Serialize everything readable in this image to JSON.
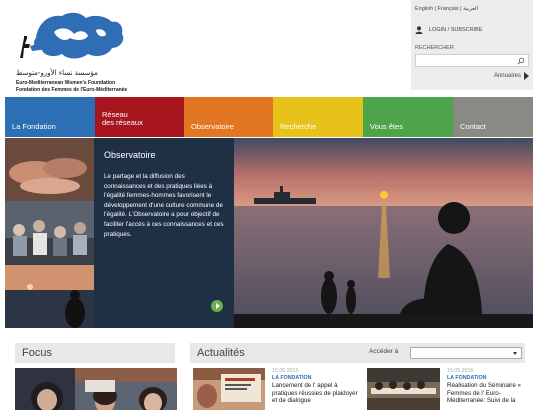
{
  "brand": {
    "arabic_name": "مؤسسة نساء الأورو-متوسط",
    "english_name": "Euro-Mediterranean Women's Foundation",
    "french_name": "Fondation des Femmes de l'Euro-Méditerranée",
    "colors": {
      "blue": "#2f6db5",
      "dark": "#1f2f44"
    }
  },
  "topbar": {
    "languages": "English | Français | العربية",
    "login": "LOGIN / SUBSCRIBE",
    "search_label": "RECHERCHER",
    "search_placeholder": "",
    "annuaires": "Annuaires"
  },
  "nav": [
    {
      "line1": "La Fondation",
      "line2": "",
      "color": "#2c6fb4"
    },
    {
      "line1": "Réseau",
      "line2": "des réseaux",
      "color": "#a7161f"
    },
    {
      "line1": "Observatoire",
      "line2": "",
      "color": "#e37622"
    },
    {
      "line1": "Recherche",
      "line2": "",
      "color": "#e6c21b"
    },
    {
      "line1": "Vous êtes",
      "line2": "",
      "color": "#4ea44a"
    },
    {
      "line1": "Contact",
      "line2": "",
      "color": "#8a8a85"
    }
  ],
  "hero": {
    "title": "Observatoire",
    "text": "Le partage et la diffusion des connaissances et des pratiques liées à l'égalité femmes-hommes favorisent le développement d'une culture commune de l'égalité. L'Observatoire a pour objectif de faciliter l'accès à ces connaissances et ces pratiques."
  },
  "focus": {
    "heading": "Focus"
  },
  "actualites": {
    "heading": "Actualités",
    "acceder_label": "Accéder à",
    "select_value": "",
    "items": [
      {
        "date": "15.05.2015",
        "category": "LA FONDATION",
        "title": "Lancement de l' appel à pratiques réussies de plaidoyer et de dialogue"
      },
      {
        "date": "15.05.2015",
        "category": "LA FONDATION",
        "title": "Réalisation du Séminaire « Femmes de l' Euro-Méditerranée: Suivi de la"
      }
    ]
  }
}
